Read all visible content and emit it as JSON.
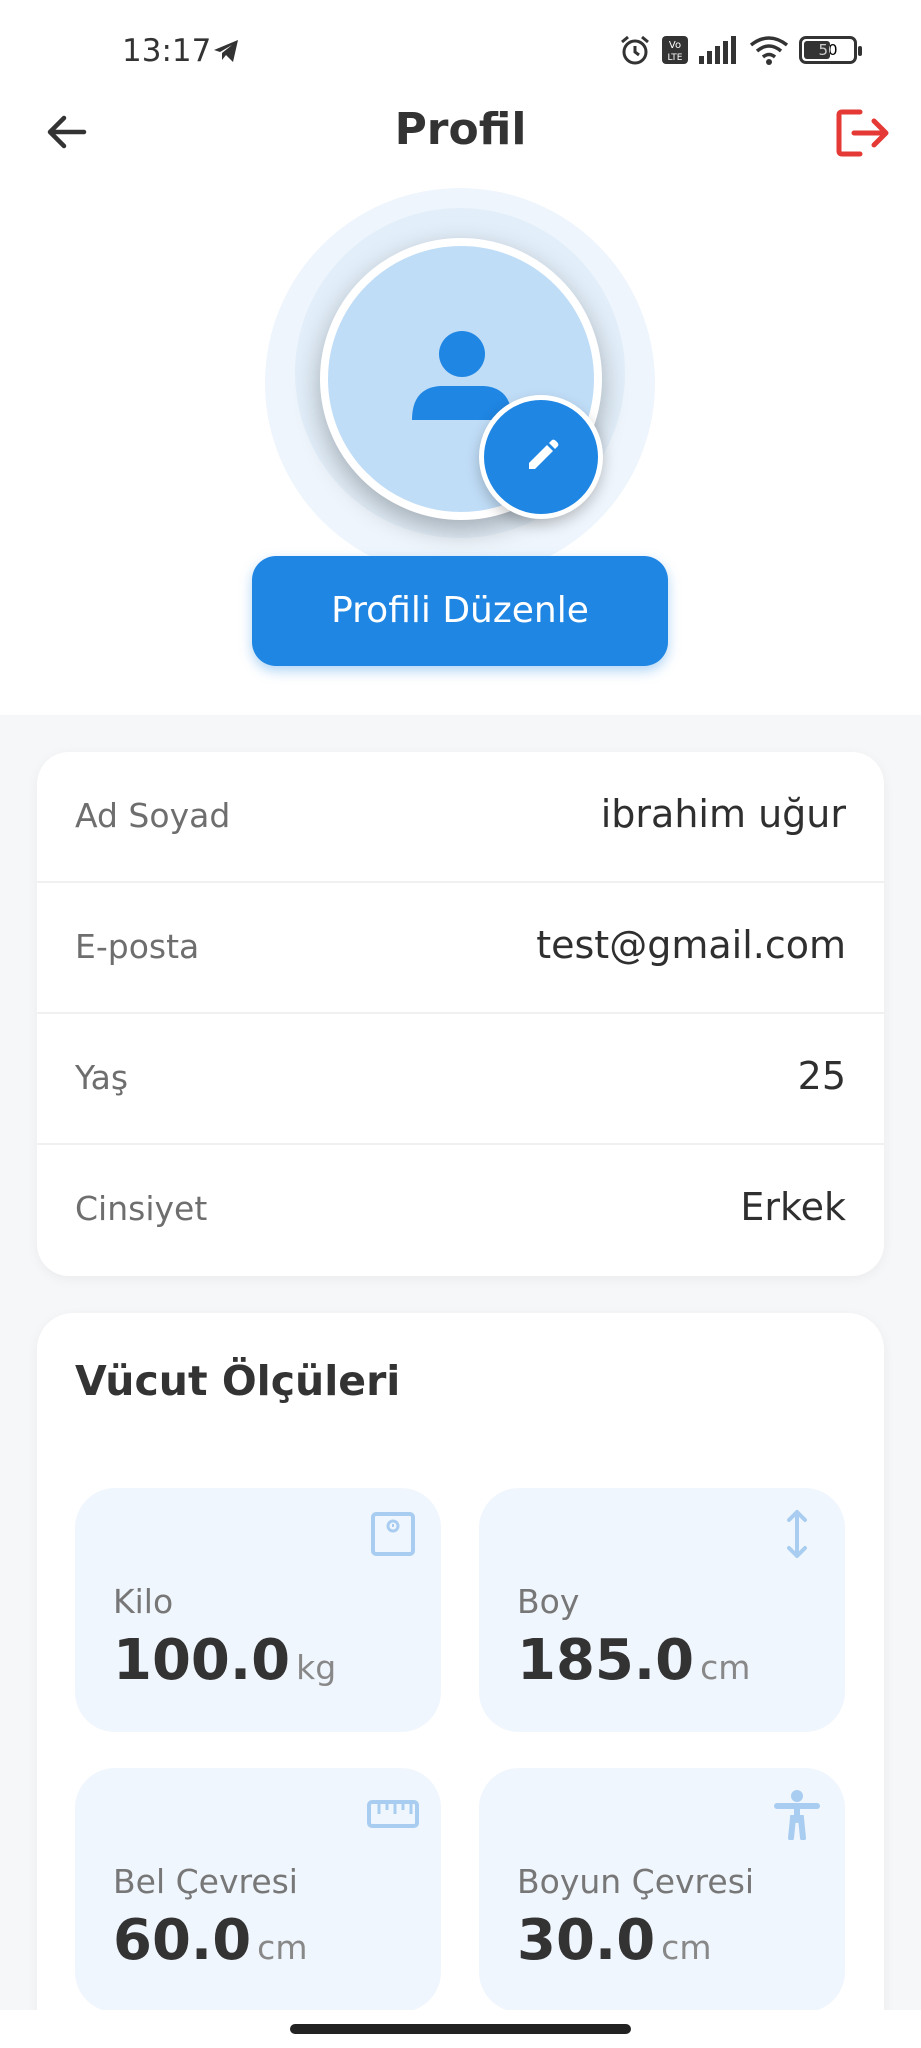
{
  "status_bar": {
    "time": "13:17",
    "battery_level": "50",
    "icons": [
      "telegram-icon",
      "alarm-icon",
      "volte-icon",
      "signal-icon",
      "wifi-icon",
      "battery-icon"
    ]
  },
  "header": {
    "title": "Profil",
    "back_icon": "arrow-left-icon",
    "logout_icon": "logout-icon"
  },
  "profile": {
    "avatar_icon": "person-icon",
    "edit_avatar_icon": "pencil-icon",
    "edit_button_label": "Profili Düzenle"
  },
  "info": {
    "rows": [
      {
        "label": "Ad Soyad",
        "value": "ibrahim uğur"
      },
      {
        "label": "E-posta",
        "value": "test@gmail.com"
      },
      {
        "label": "Yaş",
        "value": "25"
      },
      {
        "label": "Cinsiyet",
        "value": "Erkek"
      }
    ]
  },
  "measurements": {
    "title": "Vücut Ölçüleri",
    "items": [
      {
        "label": "Kilo",
        "value": "100.0",
        "unit": "kg",
        "icon": "scale-icon"
      },
      {
        "label": "Boy",
        "value": "185.0",
        "unit": "cm",
        "icon": "height-icon"
      },
      {
        "label": "Bel Çevresi",
        "value": "60.0",
        "unit": "cm",
        "icon": "ruler-icon"
      },
      {
        "label": "Boyun Çevresi",
        "value": "30.0",
        "unit": "cm",
        "icon": "body-icon"
      }
    ]
  },
  "colors": {
    "primary": "#1f86e3",
    "logout": "#e53935",
    "tile_bg": "#f0f6fd",
    "avatar_bg": "#c0ddf7"
  }
}
